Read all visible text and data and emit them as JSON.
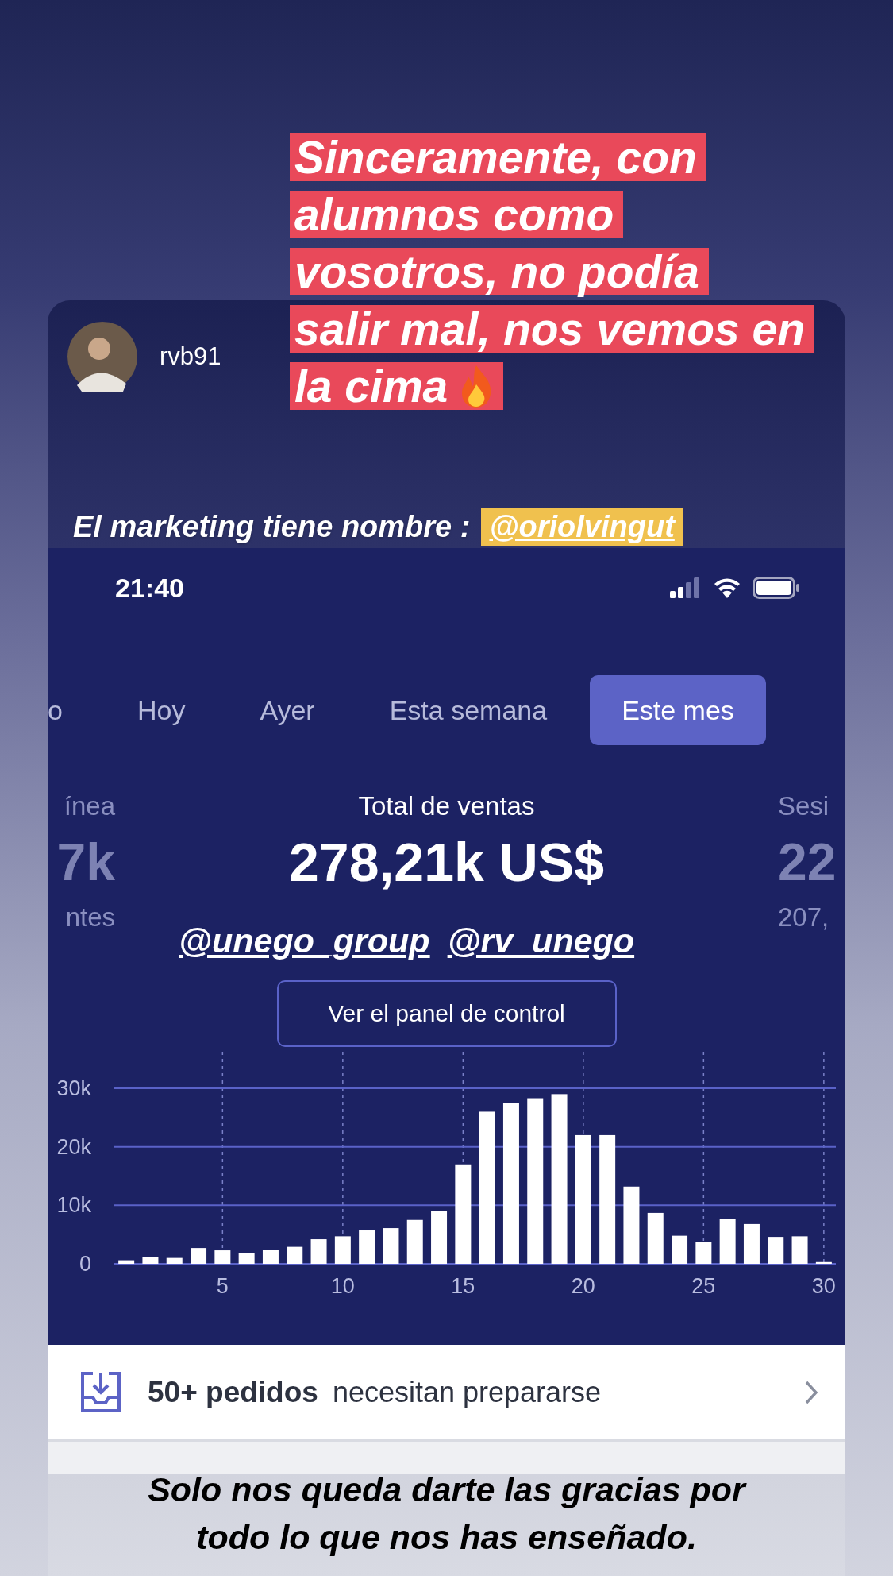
{
  "story": {
    "username": "rvb91"
  },
  "caption_lines": [
    "Sinceramente, con",
    "alumnos como",
    "vosotros, no podía",
    "salir mal, nos vemos en",
    "la cima"
  ],
  "marketing": {
    "text": "El marketing tiene nombre :",
    "mention": "@oriolvingut"
  },
  "status_bar": {
    "time": "21:40"
  },
  "tabs": [
    {
      "label": "o",
      "selected": false
    },
    {
      "label": "Hoy",
      "selected": false
    },
    {
      "label": "Ayer",
      "selected": false
    },
    {
      "label": "Esta semana",
      "selected": false
    },
    {
      "label": "Este mes",
      "selected": true
    }
  ],
  "metrics": [
    {
      "kind": "cut_left",
      "label": "ínea",
      "value": "7k",
      "caption": "ntes"
    },
    {
      "kind": "main",
      "label": "Total de ventas",
      "value": "278,21k US$"
    },
    {
      "kind": "cut_right",
      "label": "Sesi",
      "value": "22",
      "caption": "207,"
    }
  ],
  "mentions": [
    "@unego_group",
    "@rv_unego"
  ],
  "dashboard_button": "Ver el panel de control",
  "chart": {
    "chart_data": {
      "type": "bar",
      "x": [
        1,
        2,
        3,
        4,
        5,
        6,
        7,
        8,
        9,
        10,
        11,
        12,
        13,
        14,
        15,
        16,
        17,
        18,
        19,
        20,
        21,
        22,
        23,
        24,
        25,
        26,
        27,
        28,
        29,
        30
      ],
      "values": [
        600,
        1200,
        1000,
        2700,
        2300,
        1800,
        2400,
        2900,
        4200,
        4700,
        5700,
        6100,
        7500,
        9000,
        17000,
        26000,
        27500,
        28300,
        29000,
        22000,
        22000,
        13200,
        8700,
        4800,
        3800,
        7700,
        6800,
        4600,
        4700,
        300
      ],
      "xlim": [
        0.5,
        30.5
      ],
      "ylim": [
        0,
        30000
      ],
      "grid": true,
      "yticks": [
        {
          "value": 0,
          "label": "0"
        },
        {
          "value": 10000,
          "label": "10k"
        },
        {
          "value": 20000,
          "label": "20k"
        },
        {
          "value": 30000,
          "label": "30k"
        }
      ],
      "xticks": [
        5,
        10,
        15,
        20,
        25,
        30
      ]
    }
  },
  "notice": {
    "count": "50+ pedidos",
    "text": "necesitan prepararse"
  },
  "thanks": "Solo nos queda darte las gracias por\ntodo lo que nos has enseñado."
}
